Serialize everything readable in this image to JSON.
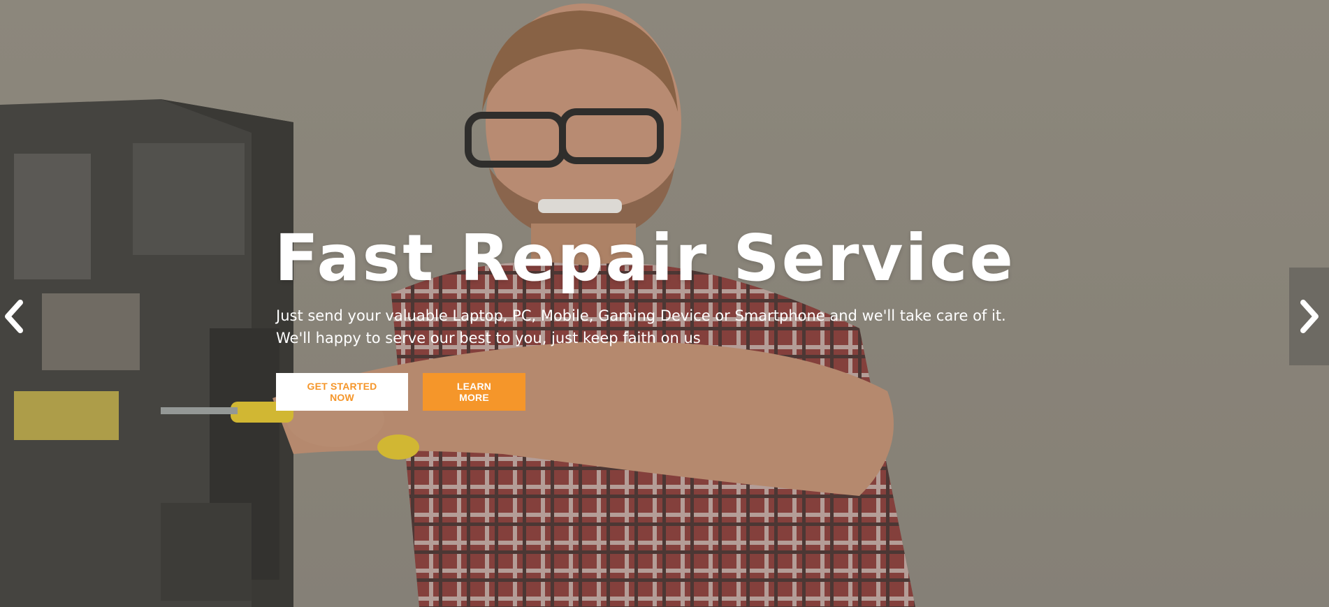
{
  "hero": {
    "title": "Fast Repair Service",
    "subtitle_line1": "Just send your valuable Laptop, PC, Mobile, Gaming Device or Smartphone and we'll take care of it.",
    "subtitle_line2": "We'll happy to serve our best to you, just keep faith on us",
    "primary_button": "GET STARTED NOW",
    "secondary_button": "LEARN MORE"
  },
  "slider": {
    "prev_icon": "chevron-left-icon",
    "next_icon": "chevron-right-icon"
  },
  "colors": {
    "accent": "#f5962a",
    "overlay": "#8c877c",
    "text": "#ffffff"
  }
}
